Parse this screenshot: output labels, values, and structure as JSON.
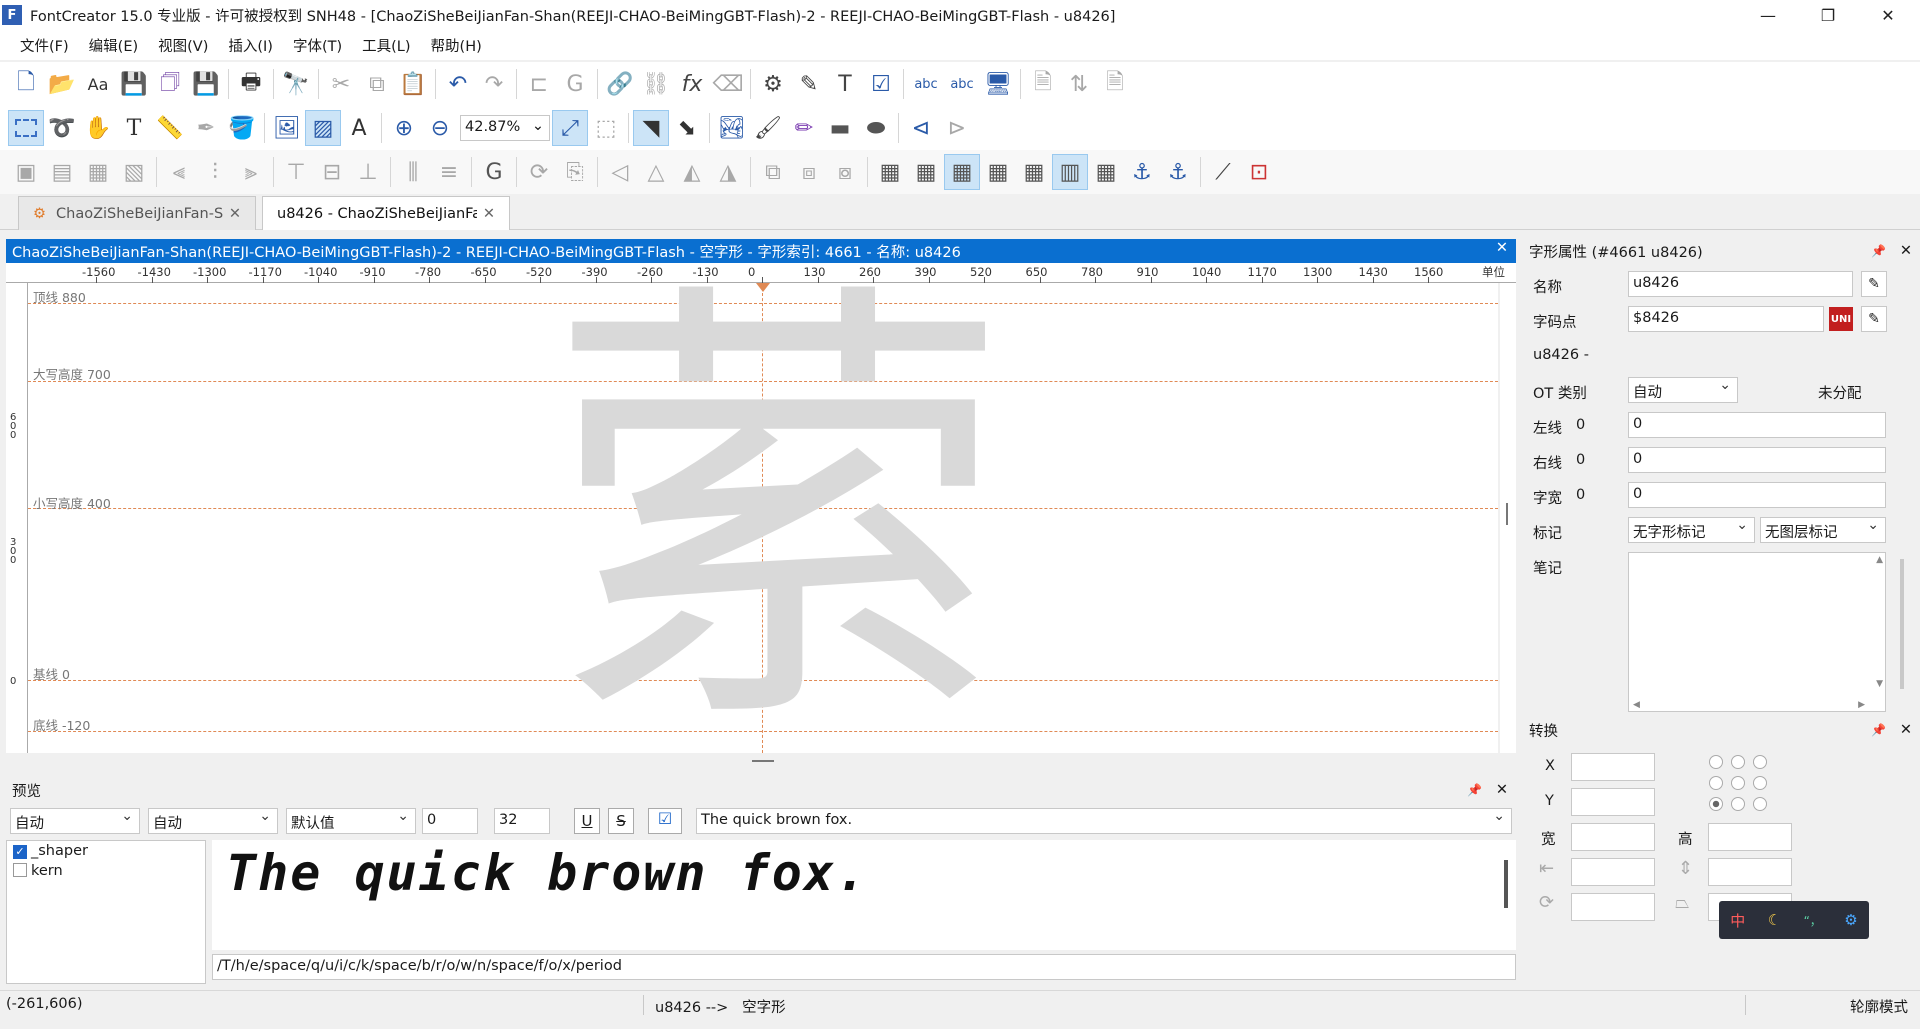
{
  "title_bar": {
    "title": "FontCreator 15.0 专业版 - 许可被授权到 SNH48 - [ChaoZiSheBeiJianFan-Shan(REEJI-CHAO-BeiMingGBT-Flash)-2 - REEJI-CHAO-BeiMingGBT-Flash - u8426]",
    "app_icon": "F"
  },
  "menu": [
    "文件(F)",
    "编辑(E)",
    "视图(V)",
    "插入(I)",
    "字体(T)",
    "工具(L)",
    "帮助(H)"
  ],
  "toolbar": {
    "zoom": "42.87%"
  },
  "tabs": [
    {
      "label": "ChaoZiSheBeiJianFan-S"
    },
    {
      "label": "u8426 - ChaoZiSheBeiJianFa"
    }
  ],
  "editor": {
    "header": "ChaoZiSheBeiJianFan-Shan(REEJI-CHAO-BeiMingGBT-Flash)-2 - REEJI-CHAO-BeiMingGBT-Flash - 空字形 - 字形索引: 4661 - 名称: u8426",
    "ruler_ticks": [
      "-1560",
      "-1430",
      "-1300",
      "-1170",
      "-1040",
      "-910",
      "-780",
      "-650",
      "-520",
      "-390",
      "-260",
      "-130",
      "0",
      "130",
      "260",
      "390",
      "520",
      "650",
      "780",
      "910",
      "1040",
      "1170",
      "1300",
      "1430",
      "1560"
    ],
    "ruler_unit": "单位",
    "vruler_labels": [
      "6\n0\n0",
      "3\n0\n0",
      "0"
    ],
    "guides": [
      {
        "label": "顶线 880"
      },
      {
        "label": "大写高度 700"
      },
      {
        "label": "小写高度 400"
      },
      {
        "label": "基线 0"
      },
      {
        "label": "底线 -120"
      }
    ],
    "glyph_char": "萦"
  },
  "properties": {
    "header": "字形属性 (#4661 u8426)",
    "name_label": "名称",
    "name_value": "u8426",
    "codepoint_label": "字码点",
    "codepoint_value": "$8426",
    "codepoint_text": "u8426 -",
    "ot_label": "OT 类别",
    "ot_value": "自动",
    "ot_status": "未分配",
    "lsb_label": "左线",
    "lsb_num": "0",
    "lsb_value": "0",
    "rsb_label": "右线",
    "rsb_num": "0",
    "rsb_value": "0",
    "width_label": "字宽",
    "width_num": "0",
    "width_value": "0",
    "mark_label": "标记",
    "mark_value1": "无字形标记",
    "mark_value2": "无图层标记",
    "note_label": "笔记"
  },
  "transform": {
    "header": "转换",
    "x_label": "X",
    "y_label": "Y",
    "w_label": "宽",
    "h_label": "高"
  },
  "preview": {
    "header": "预览",
    "dd1": "自动",
    "dd2": "自动",
    "dd3": "默认值",
    "spin1": "0",
    "spin2": "32",
    "text": "The quick brown fox.",
    "features": [
      {
        "name": "_shaper",
        "checked": true
      },
      {
        "name": "kern",
        "checked": false
      }
    ],
    "glyph_string": "/T/h/e/space/q/u/i/c/k/space/b/r/o/w/n/space/f/o/x/period"
  },
  "status": {
    "coords": "(-261,606)",
    "glyph_info": "u8426 -->   空字形",
    "mode": "轮廓模式"
  },
  "ime": [
    "中",
    "☾",
    "“，",
    "⚙"
  ]
}
